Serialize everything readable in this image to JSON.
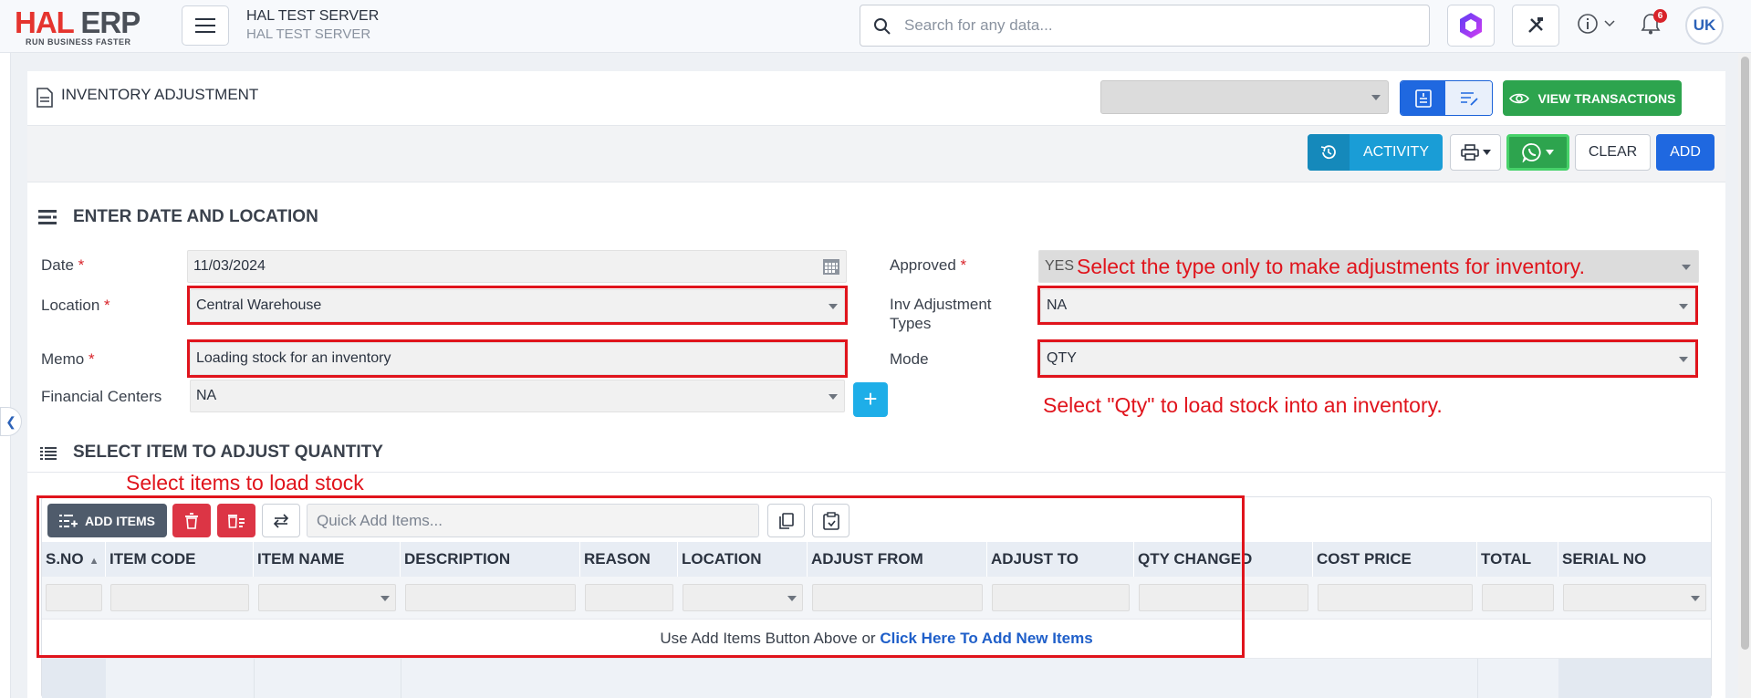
{
  "app": {
    "logo_main_a": "HAL",
    "logo_main_b": "ERP",
    "logo_sub": "RUN BUSINESS FASTER",
    "server_title": "HAL TEST SERVER",
    "server_sub": "HAL TEST SERVER",
    "search_placeholder": "Search for any data...",
    "notification_count": "6",
    "avatar_initials": "UK"
  },
  "page": {
    "title": "INVENTORY ADJUSTMENT",
    "view_transactions": "VIEW TRANSACTIONS",
    "activity": "ACTIVITY",
    "clear": "CLEAR",
    "add": "ADD"
  },
  "section1": {
    "title": "ENTER DATE AND LOCATION",
    "date_label": "Date",
    "date_value": "11/03/2024",
    "location_label": "Location",
    "location_value": "Central Warehouse",
    "memo_label": "Memo",
    "memo_value": "Loading stock for an inventory",
    "financial_label": "Financial Centers",
    "financial_value": "NA",
    "approved_label": "Approved",
    "approved_value": "YES",
    "inv_types_label_1": "Inv Adjustment",
    "inv_types_label_2": "Types",
    "inv_types_value": "NA",
    "mode_label": "Mode",
    "mode_value": "QTY",
    "required_mark": "*"
  },
  "annotations": {
    "type_note": "Select the type only to make adjustments for inventory.",
    "qty_note": "Select \"Qty\" to load stock into an inventory.",
    "items_note": "Select items to load stock",
    "color": "#e0141c"
  },
  "section2": {
    "title": "SELECT ITEM TO ADJUST QUANTITY",
    "add_items": "ADD ITEMS",
    "quick_add_placeholder": "Quick Add Items...",
    "columns": [
      "S.NO",
      "ITEM CODE",
      "ITEM NAME",
      "DESCRIPTION",
      "REASON",
      "LOCATION",
      "ADJUST FROM",
      "ADJUST TO",
      "QTY CHANGED",
      "COST PRICE",
      "TOTAL",
      "SERIAL NO"
    ],
    "empty_prefix": "Use Add Items Button Above or ",
    "empty_link": "Click Here To Add New Items"
  },
  "colors": {
    "brand_red": "#e5342e",
    "primary_blue": "#1f68e0",
    "green": "#2da44e",
    "cyan": "#1a9dd6"
  }
}
